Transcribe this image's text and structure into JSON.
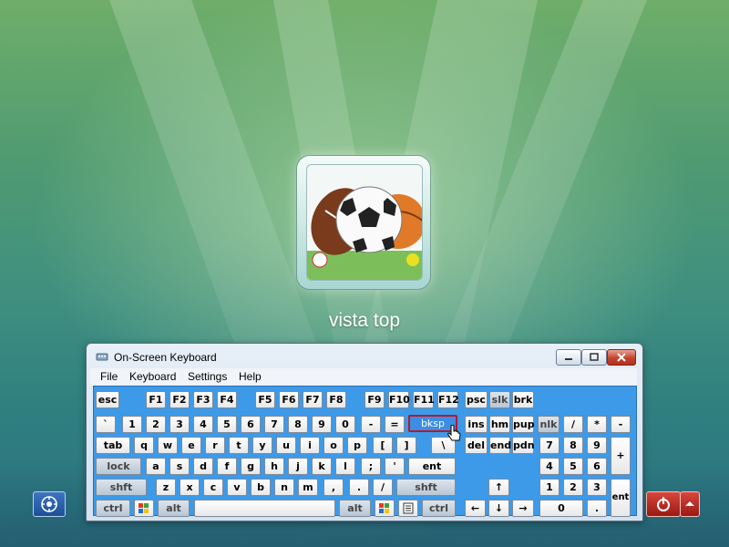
{
  "user": {
    "name": "vista top"
  },
  "window": {
    "title": "On-Screen Keyboard"
  },
  "menu": [
    "File",
    "Keyboard",
    "Settings",
    "Help"
  ],
  "keys": {
    "row1": [
      "esc",
      "F1",
      "F2",
      "F3",
      "F4",
      "F5",
      "F6",
      "F7",
      "F8",
      "F9",
      "F10",
      "F11",
      "F12",
      "psc",
      "slk",
      "brk"
    ],
    "row2": [
      "`",
      "1",
      "2",
      "3",
      "4",
      "5",
      "6",
      "7",
      "8",
      "9",
      "0",
      "-",
      "=",
      "bksp",
      "ins",
      "hm",
      "pup",
      "nlk",
      "/",
      "*",
      "-"
    ],
    "row3": [
      "tab",
      "q",
      "w",
      "e",
      "r",
      "t",
      "y",
      "u",
      "i",
      "o",
      "p",
      "[",
      "]",
      "\\",
      "del",
      "end",
      "pdn",
      "7",
      "8",
      "9",
      "+"
    ],
    "row4": [
      "lock",
      "a",
      "s",
      "d",
      "f",
      "g",
      "h",
      "j",
      "k",
      "l",
      ";",
      "'",
      "ent",
      "4",
      "5",
      "6"
    ],
    "row5": [
      "shft",
      "z",
      "x",
      "c",
      "v",
      "b",
      "n",
      "m",
      ",",
      ".",
      "/",
      "shft",
      "↑",
      "1",
      "2",
      "3",
      "ent"
    ],
    "row6": [
      "ctrl",
      "alt",
      "alt",
      "ctrl",
      "←",
      "↓",
      "→",
      "0",
      "."
    ]
  },
  "icons": {
    "ease_of_access": "ease-of-access-icon",
    "power": "power-icon",
    "windows_logo": "windows-logo-icon",
    "menu_key": "menu-key-icon",
    "pointer": "hand-pointer-icon"
  },
  "colors": {
    "keyboard_bg": "#3d9ae9",
    "highlight_border": "#b8182a",
    "power_red": "#b3201c"
  }
}
